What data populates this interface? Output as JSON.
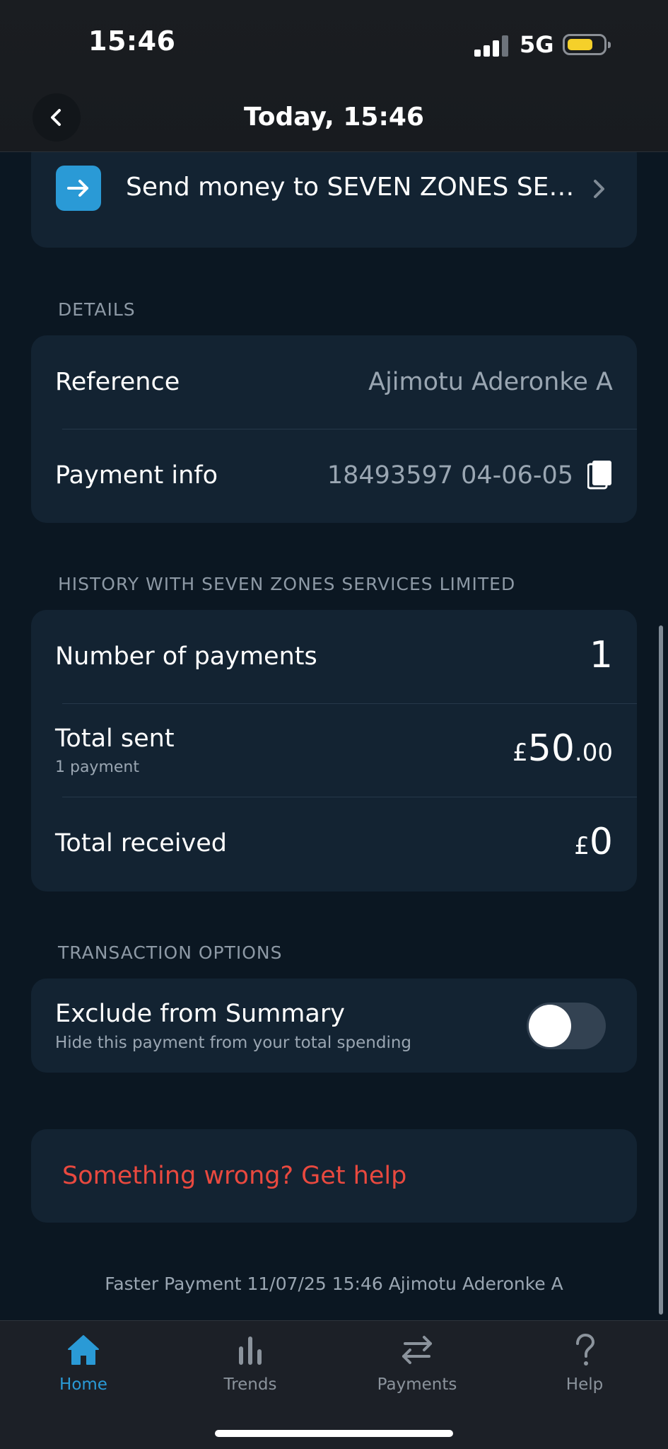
{
  "status_bar": {
    "time": "15:46",
    "network": "5G"
  },
  "header": {
    "title": "Today, 15:46"
  },
  "send_money": {
    "label": "Send money to SEVEN ZONES SE…"
  },
  "details": {
    "heading": "DETAILS",
    "reference_label": "Reference",
    "reference_value": "Ajimotu Aderonke A",
    "payment_info_label": "Payment info",
    "payment_info_value": "18493597 04-06-05"
  },
  "history": {
    "heading": "HISTORY WITH SEVEN ZONES SERVICES LIMITED",
    "number_of_payments_label": "Number of payments",
    "number_of_payments_value": "1",
    "total_sent_label": "Total sent",
    "total_sent_sub": "1 payment",
    "total_sent_currency": "£",
    "total_sent_major": "50",
    "total_sent_minor": ".00",
    "total_received_label": "Total received",
    "total_received_currency": "£",
    "total_received_major": "0"
  },
  "transaction_options": {
    "heading": "TRANSACTION OPTIONS",
    "exclude_label": "Exclude from Summary",
    "exclude_sub": "Hide this payment from your total spending",
    "exclude_enabled": false
  },
  "help": {
    "label": "Something wrong? Get help"
  },
  "footer": {
    "note": "Faster Payment 11/07/25 15:46 Ajimotu Aderonke A"
  },
  "tabbar": {
    "items": [
      {
        "label": "Home",
        "icon": "home-icon",
        "active": true
      },
      {
        "label": "Trends",
        "icon": "bar-chart-icon",
        "active": false
      },
      {
        "label": "Payments",
        "icon": "transfer-arrows-icon",
        "active": false
      },
      {
        "label": "Help",
        "icon": "question-mark-icon",
        "active": false
      }
    ]
  },
  "colors": {
    "background": "#0b1722",
    "card": "#132332",
    "accent": "#2a9ad6",
    "danger": "#e9493f",
    "battery": "#f5d02a"
  }
}
